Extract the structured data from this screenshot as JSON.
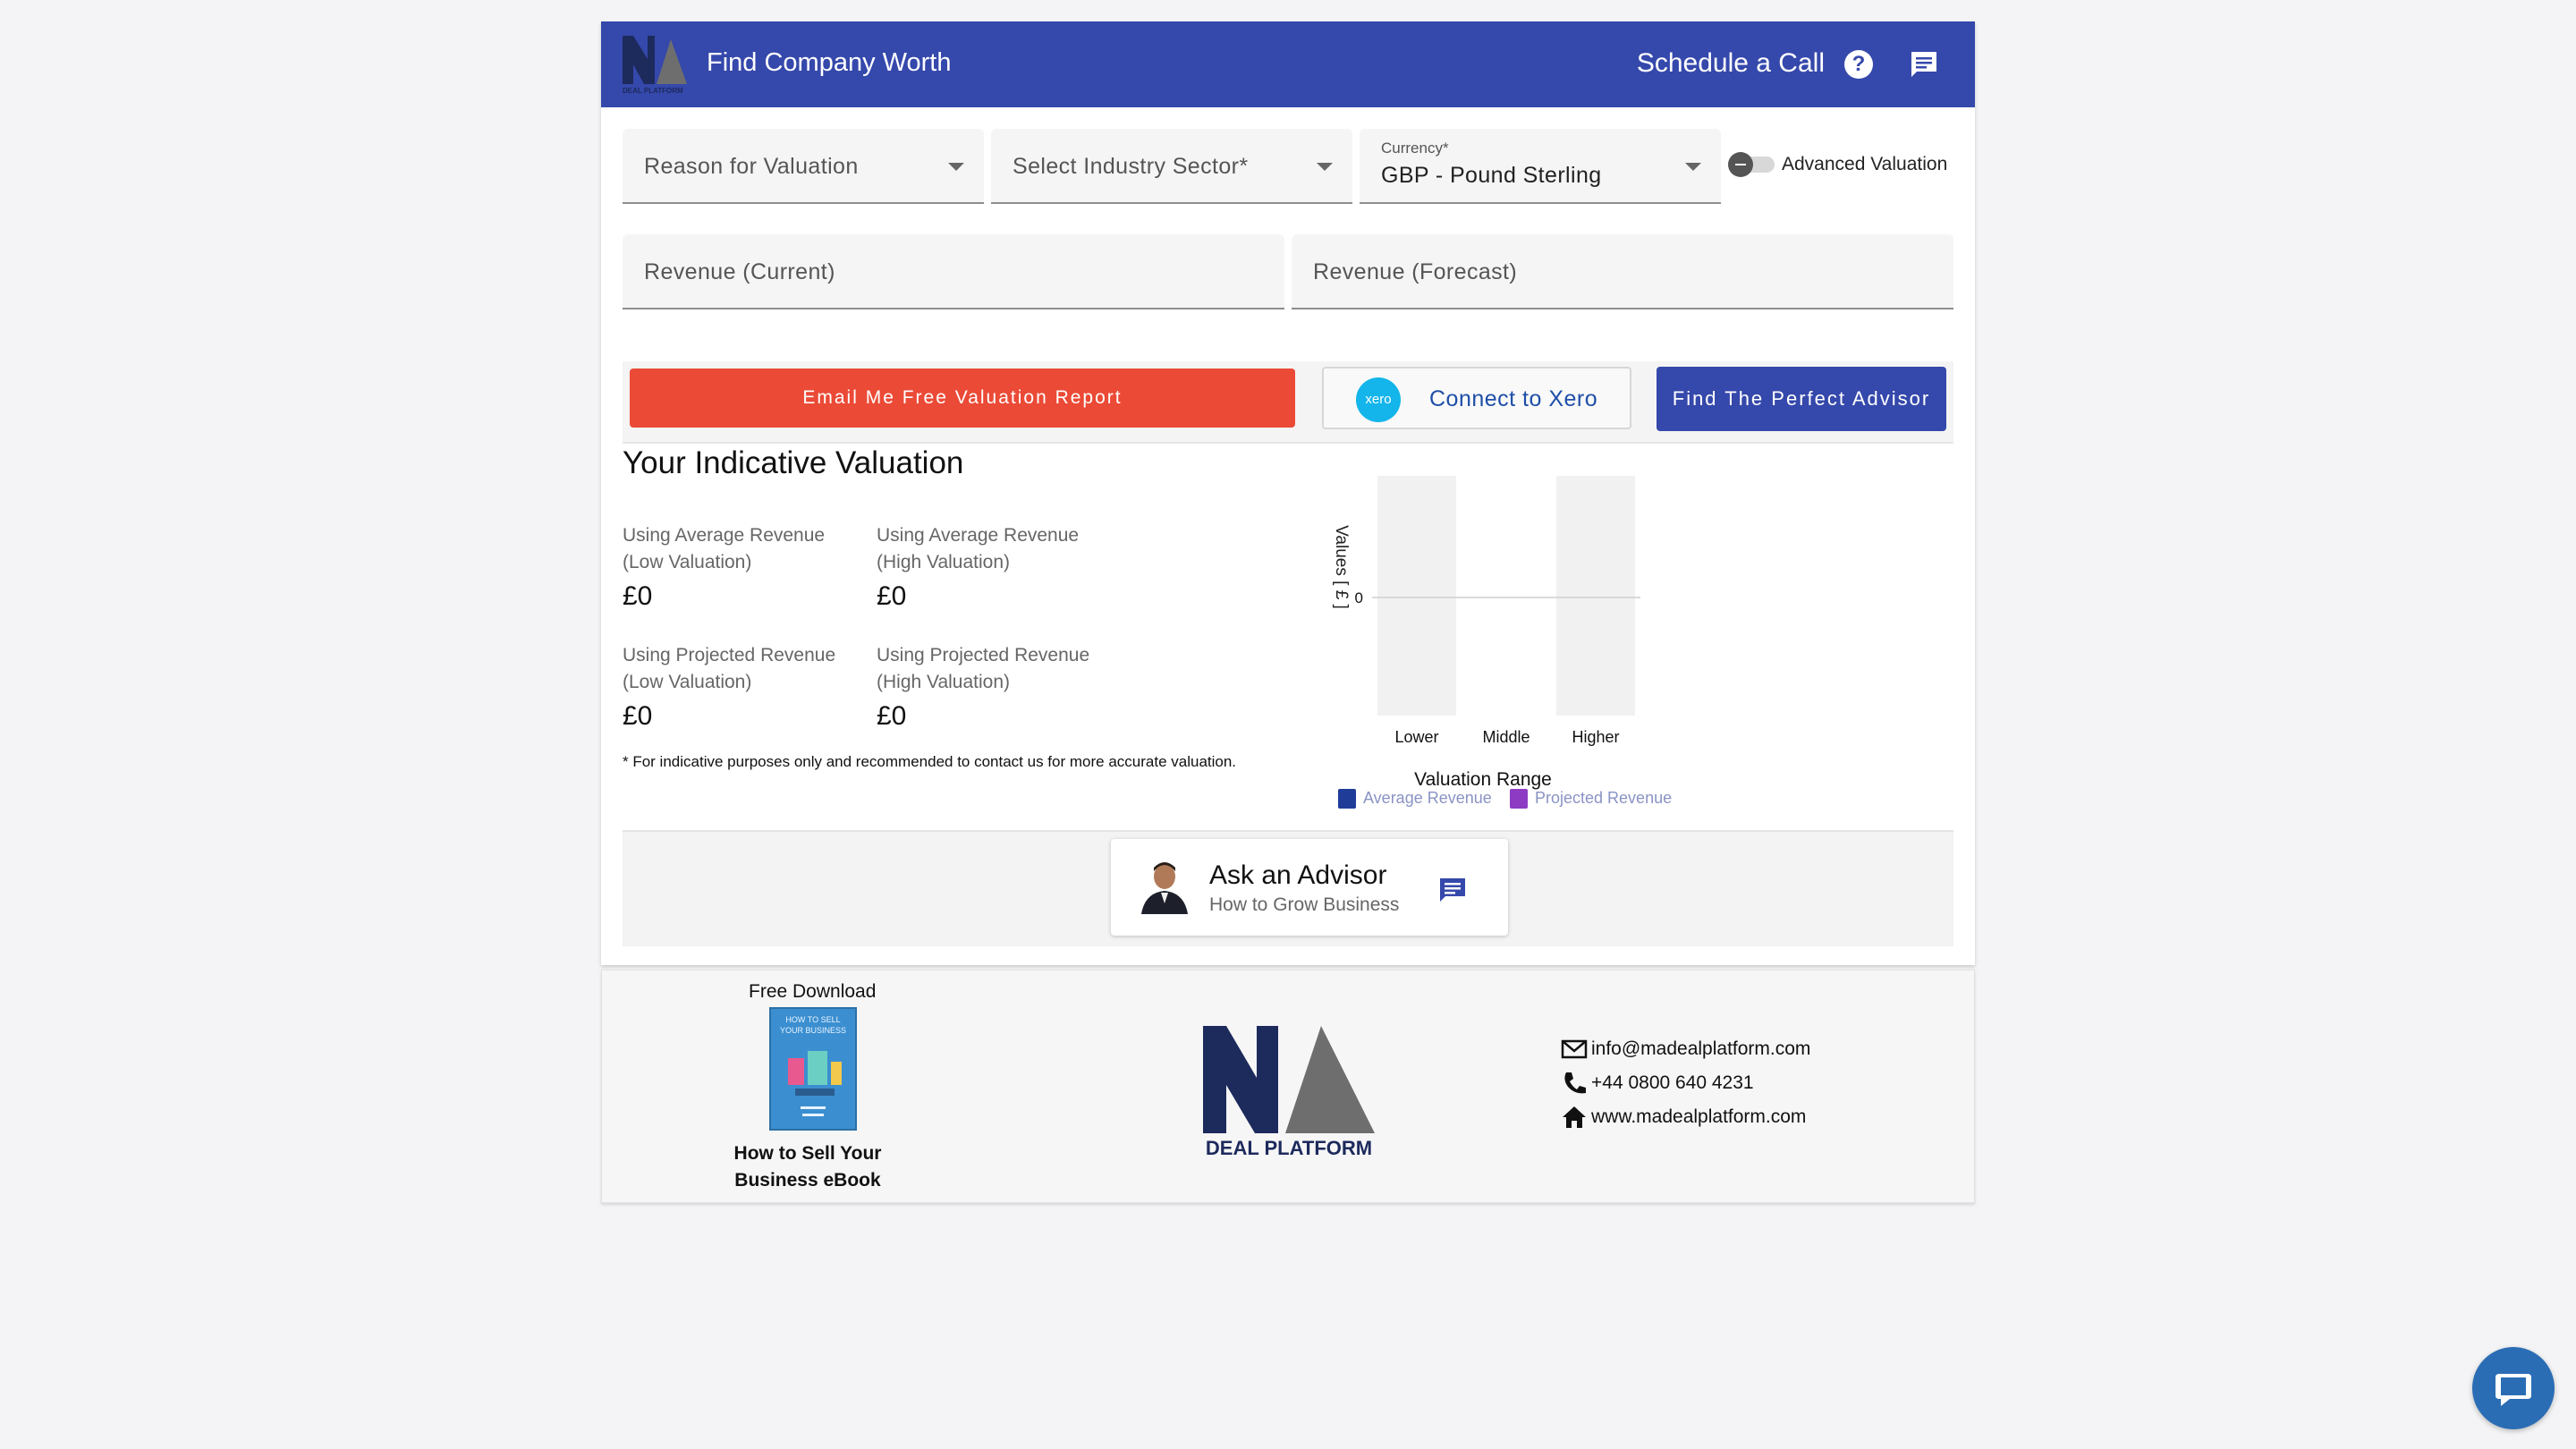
{
  "header": {
    "logo_text": "DEAL PLATFORM",
    "title": "Find Company Worth",
    "schedule_call": "Schedule a Call",
    "help_icon": "help-icon",
    "chat_icon": "chat-icon",
    "background": "#3548ab"
  },
  "form": {
    "reason_placeholder": "Reason for Valuation",
    "industry_placeholder": "Select Industry Sector*",
    "currency_label": "Currency*",
    "currency_value": "GBP - Pound Sterling",
    "advanced_toggle_label": "Advanced Valuation",
    "advanced_toggle_on": false,
    "revenue_current_placeholder": "Revenue (Current)",
    "revenue_forecast_placeholder": "Revenue (Forecast)"
  },
  "actions": {
    "email_report": "Email Me Free Valuation Report",
    "xero_logo": "xero",
    "connect_xero": "Connect to Xero",
    "find_advisor": "Find The Perfect Advisor",
    "email_color": "#eb4a36",
    "advisor_color": "#3548ab"
  },
  "valuation": {
    "title": "Your Indicative Valuation",
    "metrics": [
      {
        "label_line1": "Using Average Revenue",
        "label_line2": "(Low Valuation)",
        "value": "£0"
      },
      {
        "label_line1": "Using Average Revenue",
        "label_line2": "(High Valuation)",
        "value": "£0"
      },
      {
        "label_line1": "Using Projected Revenue",
        "label_line2": "(Low Valuation)",
        "value": "£0"
      },
      {
        "label_line1": "Using Projected Revenue",
        "label_line2": "(High Valuation)",
        "value": "£0"
      }
    ],
    "disclaimer": "* For indicative purposes only and recommended to contact us for more accurate valuation."
  },
  "chart_data": {
    "type": "bar",
    "categories": [
      "Lower",
      "Middle",
      "Higher"
    ],
    "series": [
      {
        "name": "Average Revenue",
        "values": [
          0,
          0,
          0
        ],
        "color": "#1f3c99"
      },
      {
        "name": "Projected Revenue",
        "values": [
          0,
          0,
          0
        ],
        "color": "#8e3bc4"
      }
    ],
    "xlabel": "Valuation Range",
    "ylabel": "Values [ £ ]",
    "y_ticks": [
      "0"
    ],
    "legend_position": "bottom"
  },
  "ask_advisor": {
    "title": "Ask an Advisor",
    "subtitle": "How to Grow Business"
  },
  "footer": {
    "free_download": "Free Download",
    "ebook_cover_line1": "HOW TO SELL",
    "ebook_cover_line2": "YOUR BUSINESS",
    "ebook_title_line1": "How to Sell Your",
    "ebook_title_line2": "Business eBook",
    "logo_text": "DEAL PLATFORM",
    "email": "info@madealplatform.com",
    "phone": "+44 0800 640 4231",
    "website": "www.madealplatform.com"
  }
}
